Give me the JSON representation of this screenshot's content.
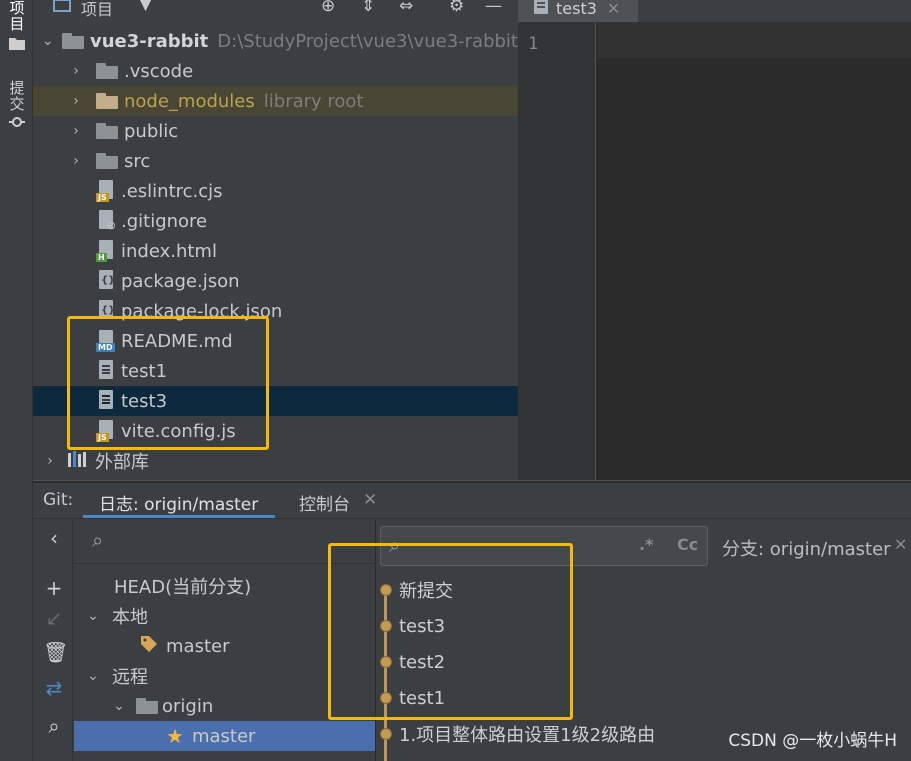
{
  "left_strip": {
    "tabs": [
      {
        "label": "项目",
        "icon": "folder-icon"
      },
      {
        "label": "提交",
        "icon": "commit-icon"
      }
    ]
  },
  "project": {
    "toolbar_label": "项目",
    "root": {
      "name": "vue3-rabbit",
      "path": "D:\\StudyProject\\vue3\\vue3-rabbit"
    },
    "items": [
      {
        "name": ".vscode",
        "type": "folder"
      },
      {
        "name": "node_modules",
        "type": "folder",
        "suffix": "library root"
      },
      {
        "name": "public",
        "type": "folder"
      },
      {
        "name": "src",
        "type": "folder"
      },
      {
        "name": ".eslintrc.cjs",
        "type": "js"
      },
      {
        "name": ".gitignore",
        "type": "ignore"
      },
      {
        "name": "index.html",
        "type": "html"
      },
      {
        "name": "package.json",
        "type": "json"
      },
      {
        "name": "package-lock.json",
        "type": "json"
      },
      {
        "name": "README.md",
        "type": "md"
      },
      {
        "name": "test1",
        "type": "text"
      },
      {
        "name": "test3",
        "type": "text"
      },
      {
        "name": "vite.config.js",
        "type": "js"
      }
    ],
    "external_libs": "外部库"
  },
  "editor": {
    "tab_label": "test3",
    "line_number": "1"
  },
  "git": {
    "tabs": {
      "git": "Git:",
      "log": "日志: origin/master",
      "console": "控制台"
    },
    "branches": {
      "head": "HEAD(当前分支)",
      "local": "本地",
      "local_master": "master",
      "remote": "远程",
      "origin": "origin",
      "remote_master": "master"
    },
    "log": {
      "branch_filter": "分支: origin/master",
      "regex_icon": ".*",
      "case_icon": "Cc",
      "commits": [
        "新提交",
        "test3",
        "test2",
        "test1",
        "1.项目整体路由设置1级2级路由"
      ]
    }
  },
  "watermark": "CSDN @一枚小蜗牛H",
  "colors": {
    "highlight_box": "#f5b90d",
    "selected": "#4b6eaf",
    "accent": "#4a88c7"
  }
}
